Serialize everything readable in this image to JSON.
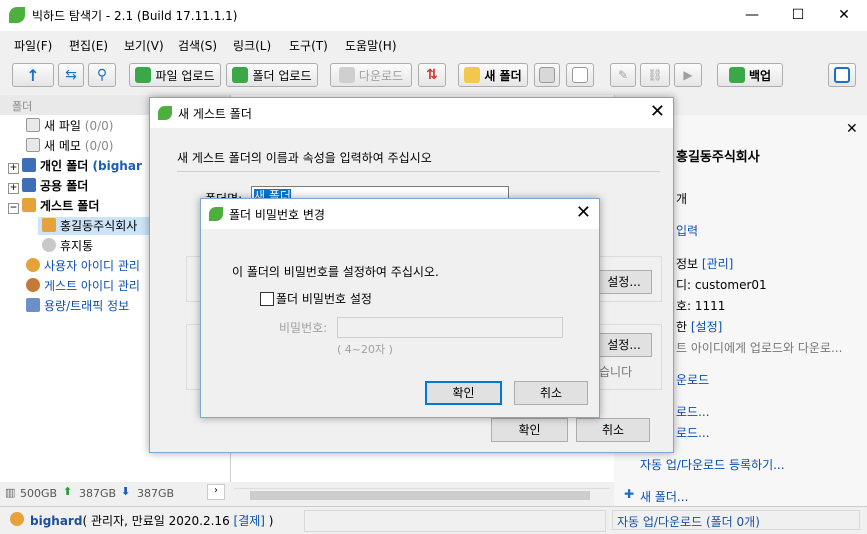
{
  "window": {
    "title": "빅하드 탐색기 - 2.1 (Build 17.11.1.1)",
    "min": "—",
    "max": "☐",
    "close": "✕"
  },
  "menu": [
    "파일(F)",
    "편집(E)",
    "보기(V)",
    "검색(S)",
    "링크(L)",
    "도구(T)",
    "도움말(H)"
  ],
  "toolbar": {
    "upload_file": "파일 업로드",
    "upload_folder": "폴더 업로드",
    "download": "다운로드",
    "new_folder": "새 폴더",
    "backup": "백업"
  },
  "left": {
    "header": "폴더",
    "items": [
      {
        "label": "새 파일",
        "count": "(0/0)"
      },
      {
        "label": "새 메모",
        "count": "(0/0)"
      },
      {
        "label": "개인 폴더",
        "extra": "(bighar"
      },
      {
        "label": "공용 폴더"
      },
      {
        "label": "게스트 폴더"
      },
      {
        "label": "홍길동주식회사"
      },
      {
        "label": "휴지통"
      },
      {
        "label": "사용자 아이디 관리"
      },
      {
        "label": "게스트 아이디 관리"
      },
      {
        "label": "용량/트래픽 정보"
      }
    ],
    "storage": {
      "total": "500GB",
      "up": "387GB",
      "down": "387GB"
    }
  },
  "right": {
    "title": "홍길동주식회사",
    "lines": [
      {
        "text": "개"
      },
      {
        "text": "입력",
        "link": true
      },
      {
        "text": "정보 ",
        "link_part": "[관리]"
      },
      {
        "text": "디: customer01"
      },
      {
        "text": "호: 1111"
      },
      {
        "text": "한 ",
        "link_part": "[설정]"
      },
      {
        "text": "트 아이디에게 업로드와 다운로..."
      },
      {
        "text": "운로드",
        "link": true
      },
      {
        "text": "로드...",
        "link": true
      },
      {
        "text": "로드...",
        "link": true
      },
      {
        "text": "자동 업/다운로드 등록하기...",
        "link": true
      },
      {
        "text": "새 폴더...",
        "link": true
      }
    ]
  },
  "status": {
    "user": "bighard",
    "info": "( 관리자, 만료일 2020.2.16 ",
    "pay": "[결제]",
    "close_paren": " )",
    "right": "자동 업/다운로드 (폴더 0개)"
  },
  "dialog_guest": {
    "title": "새 게스트 폴더",
    "instruction": "새 게스트 폴더의 이름과 속성을 입력하여 주십시오",
    "name_label": "폴더명:",
    "name_value": "새 폴더",
    "set_btn_1": "설정...",
    "set_btn_2": "설정...",
    "partial_text": "습니다",
    "ok": "확인",
    "cancel": "취소"
  },
  "dialog_password": {
    "title": "폴더 비밀번호 변경",
    "instruction": "이 폴더의 비밀번호를 설정하여 주십시오.",
    "checkbox_label": "폴더 비밀번호 설정",
    "checked": false,
    "pw_label": "비밀번호:",
    "pw_value": "",
    "hint": "( 4~20자 )",
    "ok": "확인",
    "cancel": "취소"
  }
}
